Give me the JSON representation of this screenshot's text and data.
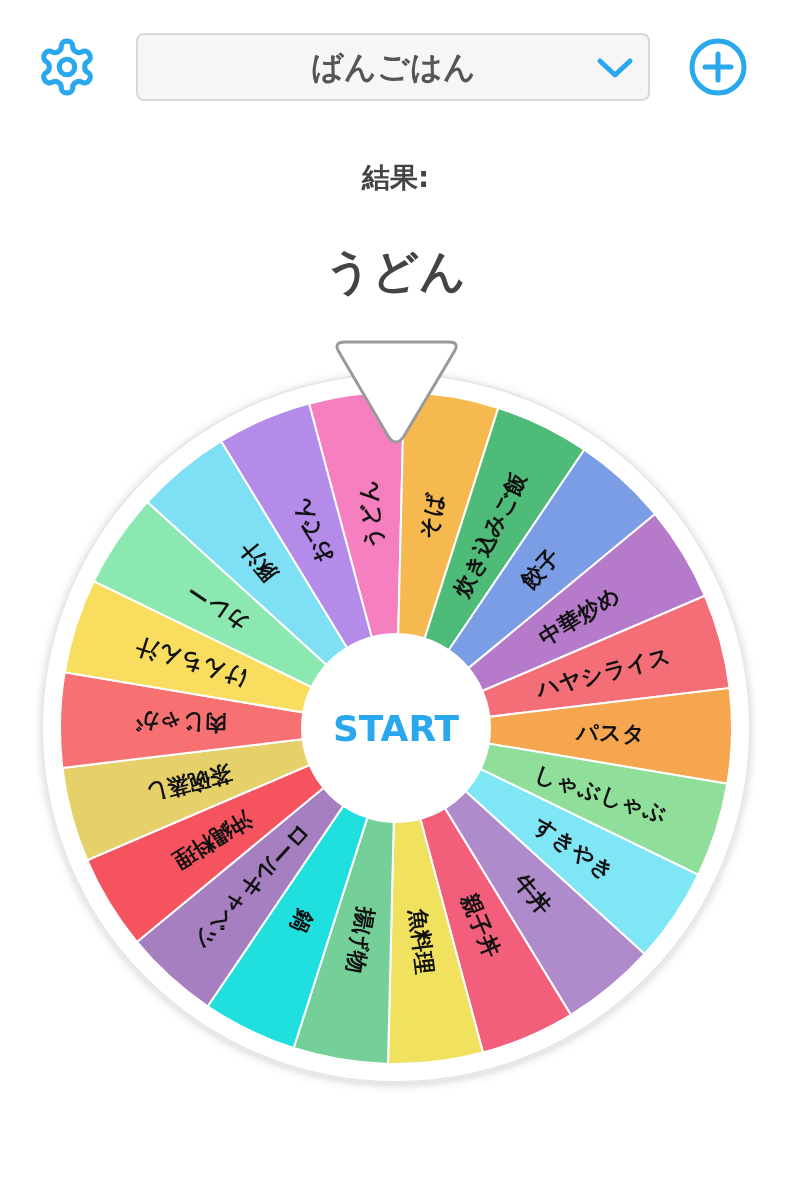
{
  "header": {
    "menu": {
      "value": "ばんごはん"
    }
  },
  "result": {
    "label": "結果:",
    "value": "うどん"
  },
  "wheel": {
    "button": "START",
    "segments": [
      {
        "label": "うどん",
        "color": "#f57fbf"
      },
      {
        "label": "そば",
        "color": "#f5b94f"
      },
      {
        "label": "炊き込みご飯",
        "color": "#4fbb78"
      },
      {
        "label": "餃子",
        "color": "#7b9de6"
      },
      {
        "label": "中華炒め",
        "color": "#b57ac9"
      },
      {
        "label": "ハヤシライス",
        "color": "#f46e78"
      },
      {
        "label": "パスタ",
        "color": "#f5a64f"
      },
      {
        "label": "しゃぶしゃぶ",
        "color": "#8fdf9a"
      },
      {
        "label": "すきやき",
        "color": "#7fe6f5"
      },
      {
        "label": "牛丼",
        "color": "#b08bcc"
      },
      {
        "label": "親子丼",
        "color": "#f35f7b"
      },
      {
        "label": "魚料理",
        "color": "#f0e15f"
      },
      {
        "label": "揚げ物",
        "color": "#74cf98"
      },
      {
        "label": "鍋",
        "color": "#1fe0df"
      },
      {
        "label": "ロールキャベツ",
        "color": "#a57fbf"
      },
      {
        "label": "沖縄料理",
        "color": "#f5545f"
      },
      {
        "label": "茶碗蒸し",
        "color": "#e5d06a"
      },
      {
        "label": "肉じゃが",
        "color": "#f77173"
      },
      {
        "label": "けんちん汁",
        "color": "#f9dd5e"
      },
      {
        "label": "カレー",
        "color": "#8be8b0"
      },
      {
        "label": "豚汁",
        "color": "#7fdff5"
      },
      {
        "label": "おでん",
        "color": "#b48be9"
      }
    ]
  }
}
